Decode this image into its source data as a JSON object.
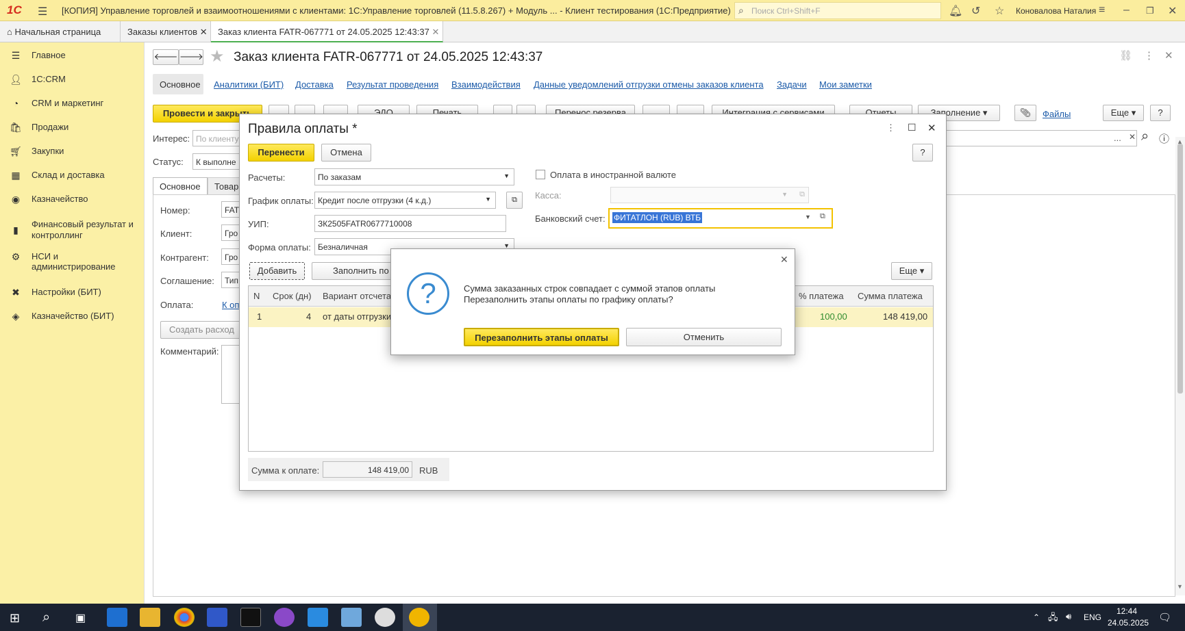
{
  "window": {
    "logo": "1С",
    "title": "[КОПИЯ] Управление торговлей и взаимоотношениями с клиентами: 1С:Управление торговлей (11.5.8.267) + Модуль ... - Клиент тестирования (1С:Предприятие)",
    "search_placeholder": "Поиск Ctrl+Shift+F",
    "user": "Коновалова Наталия"
  },
  "tabs": [
    "Начальная страница",
    "Заказы клиентов",
    "Заказ клиента FATR-067771 от 24.05.2025 12:43:37"
  ],
  "sidebar": [
    {
      "label": "Главное",
      "icon": "menu-icon"
    },
    {
      "label": "1С:CRM",
      "icon": "person-icon"
    },
    {
      "label": "CRM и маркетинг",
      "icon": "chart-pie-icon"
    },
    {
      "label": "Продажи",
      "icon": "bag-icon"
    },
    {
      "label": "Закупки",
      "icon": "cart-icon"
    },
    {
      "label": "Склад и доставка",
      "icon": "grid-icon"
    },
    {
      "label": "Казначейство",
      "icon": "coin-icon"
    },
    {
      "label": "Финансовый результат и контроллинг",
      "icon": "bars-icon"
    },
    {
      "label": "НСИ и администрирование",
      "icon": "gear-icon"
    },
    {
      "label": "Настройки (БИТ)",
      "icon": "wrench-icon"
    },
    {
      "label": "Казначейство (БИТ)",
      "icon": "layers-icon"
    }
  ],
  "doc": {
    "title": "Заказ клиента FATR-067771 от 24.05.2025 12:43:37",
    "nav": [
      "Основное",
      "Аналитики (БИТ)",
      "Доставка",
      "Результат проведения",
      "Взаимодействия",
      "Данные уведомлений отгрузки отмены заказов клиента",
      "Задачи",
      "Мои заметки"
    ],
    "post_close": "Провести и закрыть",
    "edo": "ЭДО",
    "print": "Печать",
    "reserve": "Перенос резерва",
    "integration": "Интеграция с сервисами",
    "reports": "Отчеты",
    "fill": "Заполнение",
    "files": "Файлы",
    "more": "Еще",
    "help": "?",
    "interest_label": "Интерес:",
    "interest_ph": "По клиенту",
    "status_label": "Статус:",
    "status_value": "К выполне",
    "subtabs": [
      "Основное",
      "Товар"
    ],
    "number_label": "Номер:",
    "number_value": "FAT",
    "client_label": "Клиент:",
    "client_value": "Гро",
    "contractor_label": "Контрагент:",
    "contractor_value": "Гро",
    "agreement_label": "Соглашение:",
    "agreement_value": "Тип",
    "payment_label": "Оплата:",
    "payment_link": "К оп",
    "create_button": "Создать расход",
    "comment_label": "Комментарий:"
  },
  "dialog": {
    "title": "Правила оплаты *",
    "transfer": "Перенести",
    "cancel": "Отмена",
    "help": "?",
    "calc_label": "Расчеты:",
    "calc_value": "По заказам",
    "schedule_label": "График оплаты:",
    "schedule_value": "Кредит после отгрузки (4 к.д.)",
    "uip_label": "УИП:",
    "uip_value": "ЗК2505FATR0677710008",
    "form_label": "Форма оплаты:",
    "form_value": "Безналичная",
    "foreign_label": "Оплата в иностранной валюте",
    "cash_label": "Касса:",
    "bank_label": "Банковский счет:",
    "bank_value": "ФИТАТЛОН (RUB) ВТБ",
    "add": "Добавить",
    "fill_by": "Заполнить по",
    "more": "Еще",
    "columns": [
      "N",
      "Срок (дн)",
      "Вариант отсчета",
      "% платежа",
      "Сумма платежа"
    ],
    "rows": [
      {
        "n": "1",
        "days": "4",
        "variant": "от даты отгрузки",
        "percent": "100,00",
        "sum": "148 419,00"
      }
    ],
    "total_label": "Сумма к оплате:",
    "total_value": "148 419,00",
    "currency": "RUB"
  },
  "message": {
    "line1": "Сумма заказанных строк совпадает с суммой этапов оплаты",
    "line2": "Перезаполнить этапы оплаты по графику оплаты?",
    "confirm": "Перезаполнить этапы оплаты",
    "cancel": "Отменить"
  },
  "taskbar": {
    "lang": "ENG",
    "time": "12:44",
    "date": "24.05.2025"
  },
  "colors": {
    "accent": "#f3d200",
    "sidebar": "#fbf0a6",
    "titlebar": "#fbed9e",
    "link": "#1b5aa8"
  }
}
